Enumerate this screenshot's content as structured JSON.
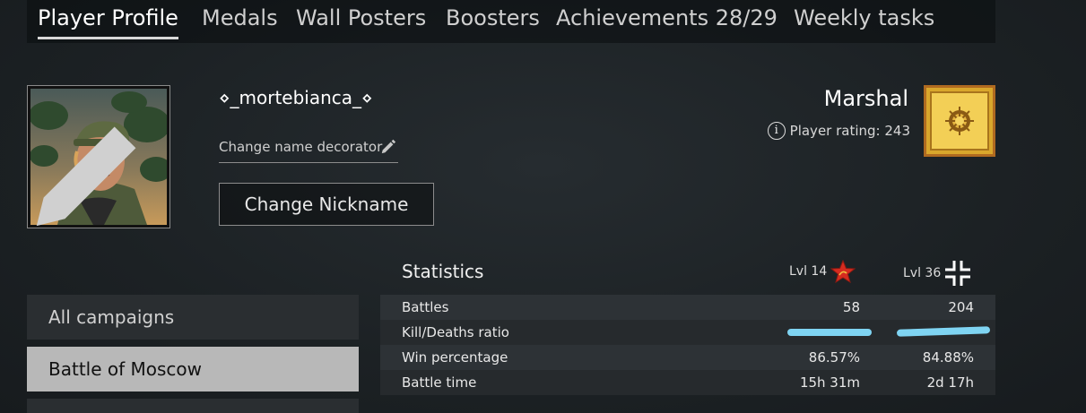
{
  "tabs": [
    {
      "label": "Player Profile",
      "active": true
    },
    {
      "label": "Medals"
    },
    {
      "label": "Wall Posters"
    },
    {
      "label": "Boosters"
    },
    {
      "label": "Achievements 28/29"
    },
    {
      "label": "Weekly tasks"
    }
  ],
  "profile": {
    "nickname": "⋄_mortebianca_⋄",
    "change_decorator_label": "Change name decorator",
    "change_nickname_label": "Change Nickname",
    "rank": "Marshal",
    "rating_label": "Player rating: 243"
  },
  "campaigns": [
    {
      "label": "All campaigns"
    },
    {
      "label": "Battle of Moscow",
      "selected": true
    }
  ],
  "statistics": {
    "title": "Statistics",
    "levels": [
      {
        "label": "Lvl 14",
        "faction_icon": "soviet-star-icon"
      },
      {
        "label": "Lvl 36",
        "faction_icon": "german-cross-icon"
      }
    ],
    "rows": [
      {
        "label": "Battles",
        "v1": "58",
        "v2": "204"
      },
      {
        "label": "Kill/Deaths ratio",
        "v1": "",
        "v2": "",
        "redacted": true
      },
      {
        "label": "Win percentage",
        "v1": "86.57%",
        "v2": "84.88%"
      },
      {
        "label": "Battle time",
        "v1": "15h 31m",
        "v2": "2d 17h"
      }
    ]
  },
  "colors": {
    "accent_gold": "#d9a72c",
    "soviet_red": "#d62b1f",
    "redaction": "#7fd4f2"
  }
}
